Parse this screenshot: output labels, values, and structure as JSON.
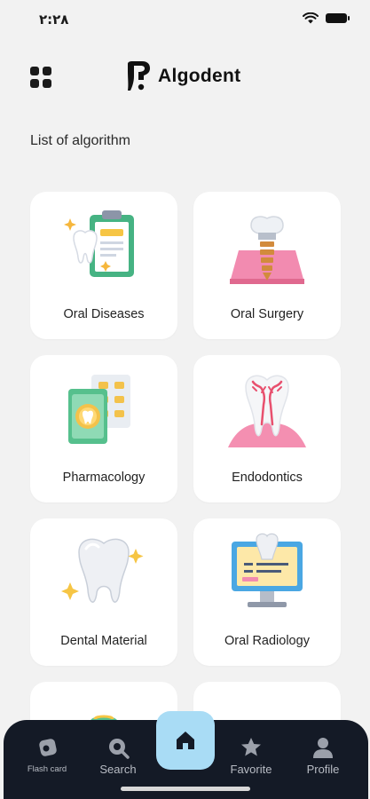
{
  "status_bar": {
    "time": "٢:٢٨",
    "wifi_icon": "wifi-icon",
    "battery_icon": "battery-icon"
  },
  "header": {
    "menu_icon": "grid-menu-icon",
    "logo_icon": "tooth-question-logo",
    "app_name": "Algodent"
  },
  "section_title": "List of algorithm",
  "categories": [
    {
      "label": "Oral Diseases",
      "icon": "clipboard-tooth-icon"
    },
    {
      "label": "Oral Surgery",
      "icon": "dental-implant-icon"
    },
    {
      "label": "Pharmacology",
      "icon": "pill-pack-icon"
    },
    {
      "label": "Endodontics",
      "icon": "tooth-root-icon"
    },
    {
      "label": "Dental Material",
      "icon": "shiny-tooth-icon"
    },
    {
      "label": "Oral Radiology",
      "icon": "xray-monitor-icon"
    },
    {
      "label": "",
      "icon": "partial-card-icon"
    },
    {
      "label": "",
      "icon": "partial-card-icon"
    }
  ],
  "tabbar": {
    "tabs": [
      {
        "label": "Flash card",
        "icon": "flashcard-icon"
      },
      {
        "label": "Search",
        "icon": "search-icon"
      },
      {
        "label": "",
        "icon": "home-icon"
      },
      {
        "label": "Favorite",
        "icon": "star-icon"
      },
      {
        "label": "Profile",
        "icon": "person-icon"
      }
    ],
    "active_color": "#a9dcf5",
    "background": "#141a26"
  }
}
